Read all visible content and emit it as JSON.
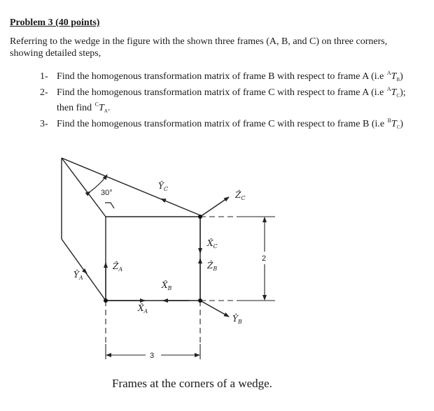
{
  "problem": {
    "title": "Problem 3 (40 points)",
    "intro": "Referring to the wedge in the figure with the shown three frames (A, B, and C) on three corners, showing detailed steps,"
  },
  "tasks": [
    {
      "number": "1-",
      "text": "Find the homogenous transformation matrix of frame B with respect to frame A (i.e ",
      "notation": {
        "sup": "A",
        "base": "T",
        "sub": "B"
      },
      "suffix": ")"
    },
    {
      "number": "2-",
      "text": "Find the homogenous transformation matrix of frame C with respect to frame A (i.e ",
      "notation": {
        "sup": "A",
        "base": "T",
        "sub": "C"
      },
      "suffix": ");",
      "continuation": {
        "text": "then find ",
        "notation": {
          "sup": "C",
          "base": "T",
          "sub": "A"
        },
        "suffix": "."
      }
    },
    {
      "number": "3-",
      "text": "Find the homogenous transformation matrix of frame C with respect to frame B (i.e ",
      "notation": {
        "sup": "B",
        "base": "T",
        "sub": "C"
      },
      "suffix": ")"
    }
  ],
  "figure": {
    "angle_label": "30°",
    "dimension_width": "3",
    "dimension_height": "2",
    "axis_labels": {
      "YA": {
        "base": "Ŷ",
        "sub": "A"
      },
      "ZA": {
        "base": "Ẑ",
        "sub": "A"
      },
      "XA": {
        "base": "X̂",
        "sub": "A"
      },
      "XB": {
        "base": "X̂",
        "sub": "B"
      },
      "ZB": {
        "base": "Ẑ",
        "sub": "B"
      },
      "YB": {
        "base": "Ŷ",
        "sub": "B"
      },
      "YC": {
        "base": "Ŷ",
        "sub": "C"
      },
      "ZC": {
        "base": "Ẑ",
        "sub": "C"
      },
      "XC": {
        "base": "X̂",
        "sub": "C"
      }
    },
    "caption": "Frames at the corners of a wedge."
  }
}
